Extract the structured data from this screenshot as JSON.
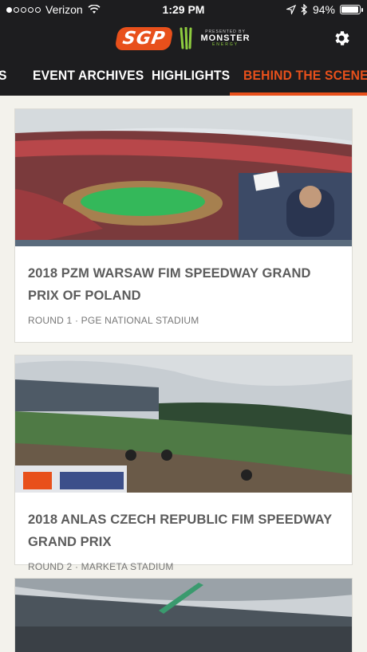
{
  "status_bar": {
    "carrier": "Verizon",
    "time": "1:29 PM",
    "battery": "94%",
    "battery_level": 0.94,
    "signal_bars": 1
  },
  "header": {
    "logo_text": "SGP",
    "sponsor_sub": "PRESENTED BY",
    "sponsor_name": "MONSTER",
    "sponsor_tag": "ENERGY",
    "settings_icon": "gear-icon"
  },
  "tabs": [
    {
      "label": "S"
    },
    {
      "label": "EVENT ARCHIVES"
    },
    {
      "label": "HIGHLIGHTS"
    },
    {
      "label": "BEHIND THE SCENES"
    }
  ],
  "active_tab": 3,
  "colors": {
    "accent": "#e8501b",
    "bar_bg": "#1d1d1f",
    "page_bg": "#f3f2ec"
  },
  "cards": [
    {
      "title": "2018 PZM WARSAW FIM SPEEDWAY GRAND PRIX OF POLAND",
      "meta": "ROUND 1 · PGE NATIONAL STADIUM"
    },
    {
      "title": "2018 ANLAS CZECH REPUBLIC FIM SPEEDWAY GRAND PRIX",
      "meta": "ROUND 2 · MARKETA STADIUM"
    }
  ]
}
